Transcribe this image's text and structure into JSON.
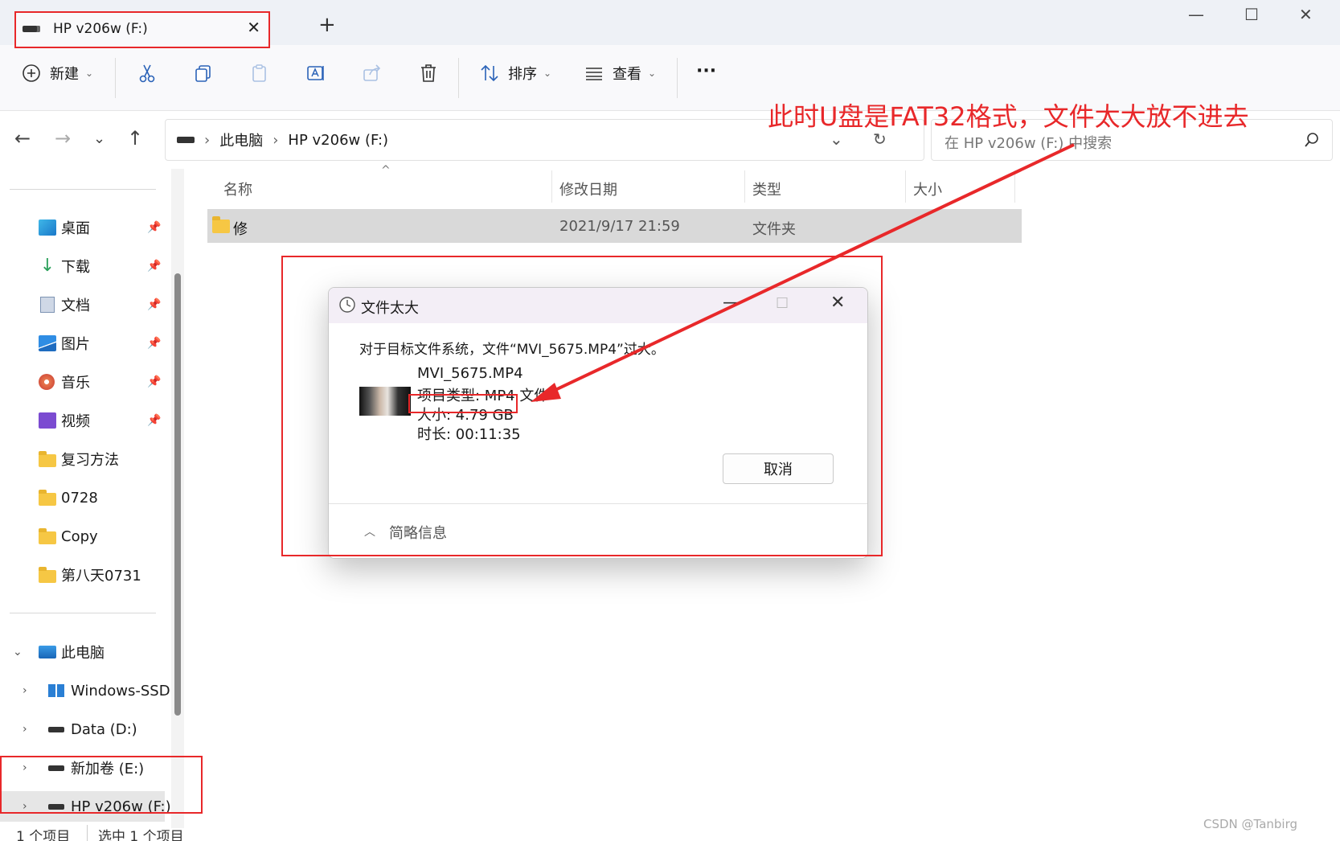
{
  "tab": {
    "title": "HP v206w (F:)",
    "close": "✕",
    "new_tab": "+"
  },
  "window": {
    "minimize": "—",
    "maximize": "☐",
    "close": "✕"
  },
  "toolbar": {
    "new_label": "新建",
    "sort_label": "排序",
    "view_label": "查看",
    "more_label": "···"
  },
  "address": {
    "crumbs": [
      "此电脑",
      "HP v206w (F:)"
    ],
    "separator": "›",
    "search_placeholder": "在 HP v206w (F:) 中搜索"
  },
  "sidebar": {
    "quick": [
      {
        "label": "桌面",
        "icon": "desktop-icon"
      },
      {
        "label": "下载",
        "icon": "download-icon"
      },
      {
        "label": "文档",
        "icon": "document-icon"
      },
      {
        "label": "图片",
        "icon": "picture-icon"
      },
      {
        "label": "音乐",
        "icon": "music-icon"
      },
      {
        "label": "视频",
        "icon": "video-icon"
      },
      {
        "label": "复习方法",
        "icon": "folder-icon"
      },
      {
        "label": "0728",
        "icon": "folder-icon"
      },
      {
        "label": "Copy",
        "icon": "folder-icon"
      },
      {
        "label": "第八天0731",
        "icon": "folder-icon"
      }
    ],
    "this_pc": "此电脑",
    "drives": [
      "Windows-SSD",
      "Data (D:)",
      "新加卷 (E:)",
      "HP v206w (F:)"
    ]
  },
  "columns": {
    "name": "名称",
    "modified": "修改日期",
    "type": "类型",
    "size": "大小"
  },
  "files": [
    {
      "name": "修",
      "modified": "2021/9/17 21:59",
      "type": "文件夹",
      "size": ""
    }
  ],
  "dialog": {
    "title": "文件太大",
    "message": "对于目标文件系统，文件“MVI_5675.MP4”过大。",
    "file_name": "MVI_5675.MP4",
    "item_type": "项目类型: MP4 文件",
    "size": "大小: 4.79 GB",
    "duration": "时长: 00:11:35",
    "cancel": "取消",
    "details": "简略信息"
  },
  "status": {
    "items": "1 个项目",
    "selected": "选中 1 个项目"
  },
  "annotation": {
    "text": "此时U盘是FAT32格式，文件太大放不进去",
    "color": "#e8282a"
  },
  "watermark": "CSDN @Tanbirg"
}
